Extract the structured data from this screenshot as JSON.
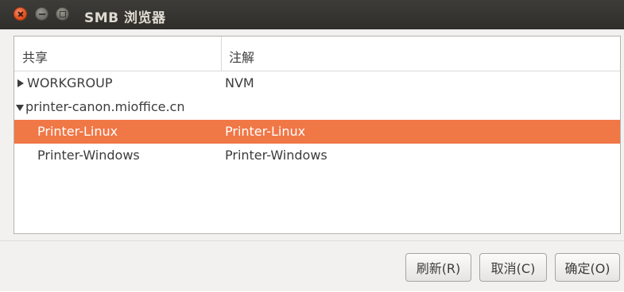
{
  "window": {
    "title": "SMB 浏览器"
  },
  "columns": {
    "share": "共享",
    "comment": "注解"
  },
  "rows": [
    {
      "share": "WORKGROUP",
      "comment": "NVM",
      "expander": "collapsed",
      "selected": false
    },
    {
      "share": "printer-canon.mioffice.cn",
      "comment": "",
      "expander": "expanded",
      "selected": false
    },
    {
      "share": "Printer-Linux",
      "comment": "Printer-Linux",
      "expander": "none",
      "selected": true
    },
    {
      "share": "Printer-Windows",
      "comment": "Printer-Windows",
      "expander": "none",
      "selected": false
    }
  ],
  "buttons": {
    "refresh": "刷新(R)",
    "cancel": "取消(C)",
    "ok": "确定(O)"
  },
  "colors": {
    "selection": "#f07746",
    "titlebar": "#3d3c38",
    "close_button": "#df4a16"
  },
  "icons": {
    "close": "close-icon",
    "minimize": "minimize-icon",
    "maximize": "maximize-icon",
    "collapsed": "triangle-right-icon",
    "expanded": "triangle-down-icon"
  }
}
